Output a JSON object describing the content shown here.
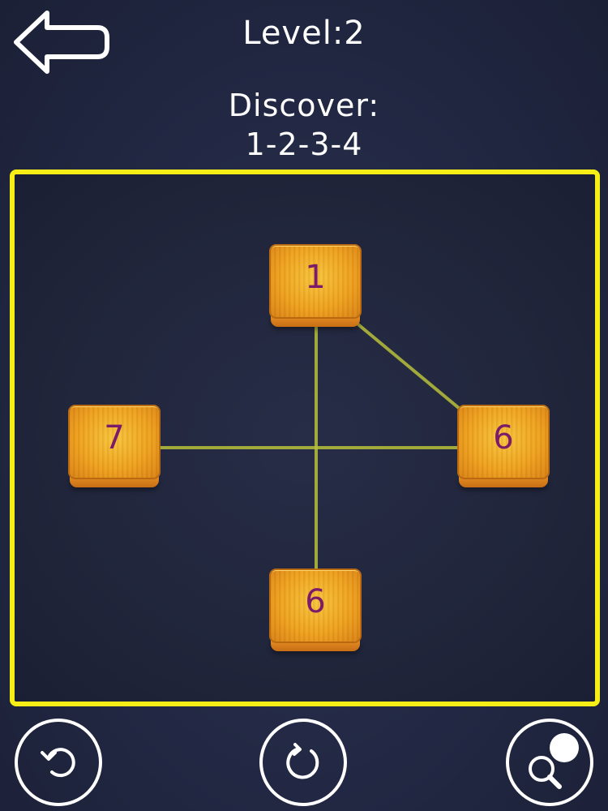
{
  "header": {
    "level": "Level:2",
    "discover_label": "Discover:",
    "discover_sequence": "1-2-3-4"
  },
  "board": {
    "tiles": [
      {
        "label": "1"
      },
      {
        "label": "7"
      },
      {
        "label": "6"
      },
      {
        "label": "6"
      }
    ],
    "border_color": "#f6ee16",
    "line_color": "#b8c03a"
  },
  "toolbar": {
    "undo_icon": "undo-icon",
    "restart_icon": "restart-icon",
    "hint_icon": "hint-magnifier-icon"
  }
}
